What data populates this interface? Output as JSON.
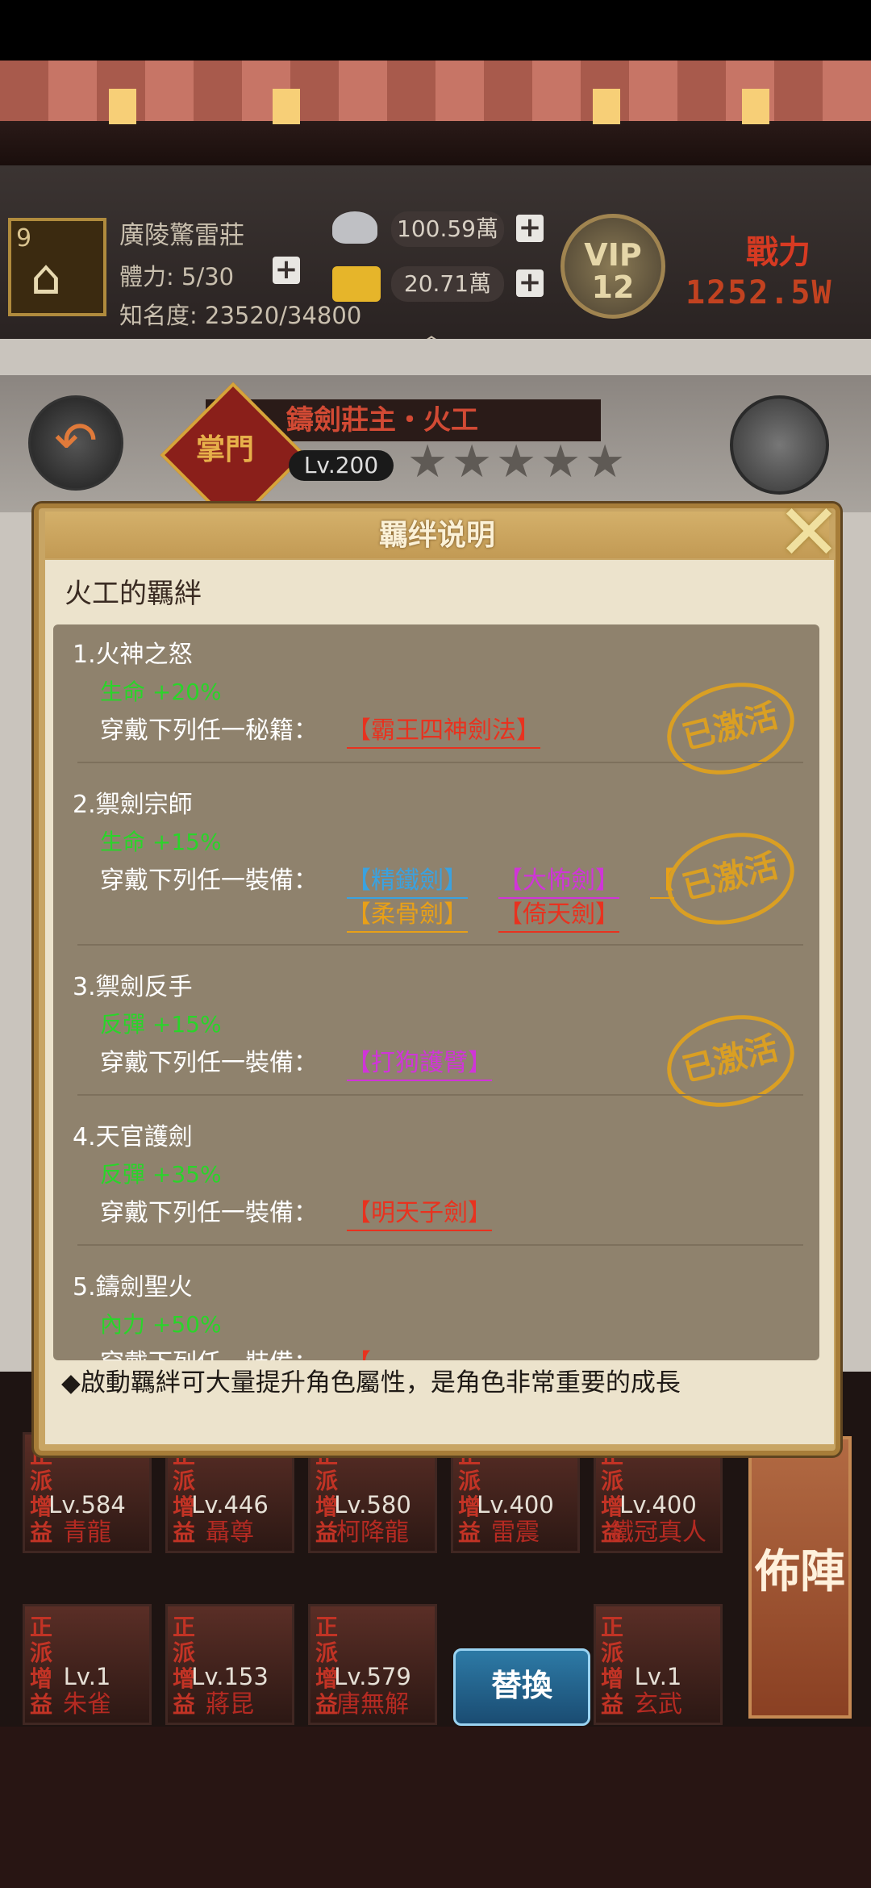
{
  "hud": {
    "level": "9",
    "player_name": "廣陵驚雷莊",
    "stamina": "體力: 5/30",
    "fame": "知名度: 23520/34800",
    "silver": "100.59萬",
    "gold": "20.71萬",
    "vip_label": "VIP",
    "vip_level": "12",
    "power_label": "戰力",
    "power_value": "1252.5W"
  },
  "hero": {
    "name": "鑄劍莊主・火工",
    "badge": "掌門",
    "level": "Lv.200",
    "stars": 5
  },
  "dialog": {
    "title": "羈绊说明",
    "heading": "火工的羈絆",
    "sections": [
      {
        "title": "1.火神之怒",
        "bonus": "生命 +20%",
        "req": "穿戴下列任一秘籍：",
        "items": [
          {
            "label": "【霸王四神劍法】",
            "color": "#e8321f"
          }
        ],
        "stamp": "已激活"
      },
      {
        "title": "2.禦劍宗師",
        "bonus": "生命 +15%",
        "req": "穿戴下列任一裝備：",
        "items": [
          {
            "label": "【精鐵劍】",
            "color": "#3aa2e0"
          },
          {
            "label": "【大怖劍】",
            "color": "#d035d8"
          },
          {
            "label": "【",
            "color": "#e8a018"
          },
          {
            "label": "【柔骨劍】",
            "color": "#e8a018"
          },
          {
            "label": "【倚天劍】",
            "color": "#e8321f"
          }
        ],
        "stamp": "已激活"
      },
      {
        "title": "3.禦劍反手",
        "bonus": "反彈 +15%",
        "req": "穿戴下列任一裝備：",
        "items": [
          {
            "label": "【打狗護臂】",
            "color": "#d035d8"
          }
        ],
        "stamp": "已激活"
      },
      {
        "title": "4.天官護劍",
        "bonus": "反彈 +35%",
        "req": "穿戴下列任一裝備：",
        "items": [
          {
            "label": "【明天子劍】",
            "color": "#e8321f"
          }
        ],
        "stamp": ""
      },
      {
        "title": "5.鑄劍聖火",
        "bonus": "內力 +50%",
        "req": "穿戴下列任一裝備：",
        "items": [
          {
            "label": "【",
            "color": "#e8321f"
          }
        ],
        "stamp": ""
      }
    ],
    "tip": "◆啟動羈絆可大量提升角色屬性，是角色非常重要的成長"
  },
  "team": {
    "row1": [
      {
        "lv": "Lv.584",
        "name": "青龍"
      },
      {
        "lv": "Lv.446",
        "name": "聶尊"
      },
      {
        "lv": "Lv.580",
        "name": "柯降龍"
      },
      {
        "lv": "Lv.400",
        "name": "雷震"
      },
      {
        "lv": "Lv.400",
        "name": "鐵冠真人"
      }
    ],
    "row2": [
      {
        "lv": "Lv.1",
        "name": "朱雀"
      },
      {
        "lv": "Lv.153",
        "name": "蔣昆"
      },
      {
        "lv": "Lv.579",
        "name": "唐無解"
      },
      {
        "lv": "",
        "name": ""
      },
      {
        "lv": "Lv.1",
        "name": "玄武"
      }
    ],
    "tag": "正派增益",
    "swap_label": "替換",
    "deploy_label": "佈陣"
  }
}
